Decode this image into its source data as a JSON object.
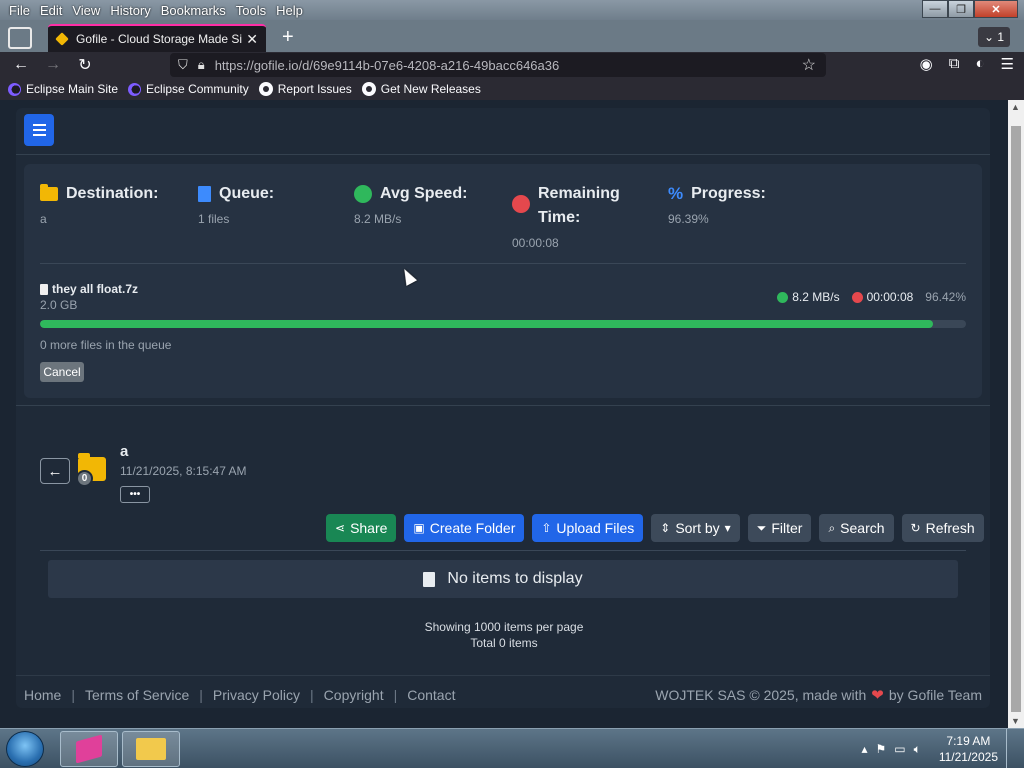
{
  "browser": {
    "menu": [
      "File",
      "Edit",
      "View",
      "History",
      "Bookmarks",
      "Tools",
      "Help"
    ],
    "tab_title": "Gofile - Cloud Storage Made Sir",
    "tab_count": "1",
    "url": "https://gofile.io/d/69e9114b-07e6-4208-a216-49bacc646a36",
    "bookmarks": [
      "Eclipse Main Site",
      "Eclipse Community",
      "Report Issues",
      "Get New Releases"
    ]
  },
  "upload": {
    "destination_label": "Destination:",
    "destination_value": "a",
    "queue_label": "Queue:",
    "queue_value": "1 files",
    "speed_label": "Avg Speed:",
    "speed_value": "8.2 MB/s",
    "remaining_label": "Remaining Time:",
    "remaining_value": "00:00:08",
    "progress_label": "Progress:",
    "progress_value": "96.39%",
    "file_name": "they all float.7z",
    "file_size": "2.0 GB",
    "file_speed": "8.2 MB/s",
    "file_time": "00:00:08",
    "file_percent": "96.42%",
    "file_progress": 96.42,
    "queue_note": "0 more files in the queue",
    "cancel_label": "Cancel"
  },
  "folder": {
    "name": "a",
    "date": "11/21/2025, 8:15:47 AM",
    "badge": "0",
    "more_label": "•••"
  },
  "toolbar": {
    "share": "Share",
    "create_folder": "Create Folder",
    "upload_files": "Upload Files",
    "sort_by": "Sort by",
    "filter": "Filter",
    "search": "Search",
    "refresh": "Refresh"
  },
  "listing": {
    "empty": "No items to display",
    "per_page": "Showing 1000 items per page",
    "total": "Total 0 items"
  },
  "footer": {
    "links": [
      "Home",
      "Terms of Service",
      "Privacy Policy",
      "Copyright",
      "Contact"
    ],
    "credit_pre": "WOJTEK SAS © 2025, made with",
    "credit_post": "by Gofile Team"
  },
  "taskbar": {
    "time": "7:19 AM",
    "date": "11/21/2025"
  },
  "colors": {
    "accent_blue": "#2166e8",
    "success_green": "#198754",
    "progress_green": "#2fb85c",
    "danger_red": "#e5484d",
    "folder_yellow": "#f2b705"
  }
}
